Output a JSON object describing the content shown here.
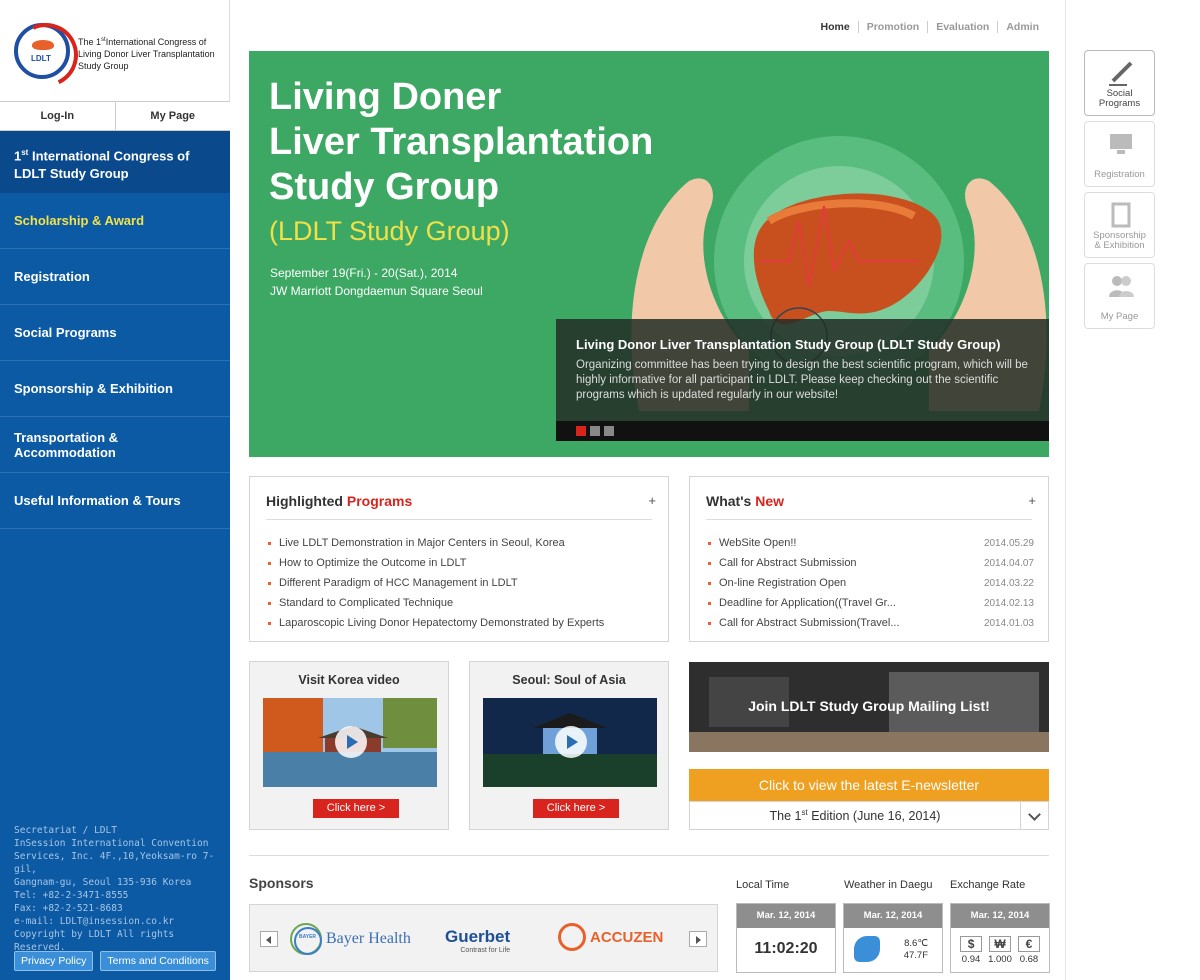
{
  "logo": {
    "badge": "LDLT",
    "title_prefix": "The 1",
    "title_sup": "st",
    "title_rest": "International Congress of Living Donor Liver Transplantation Study Group"
  },
  "account": {
    "login": "Log-In",
    "mypage": "My Page"
  },
  "nav": {
    "head_prefix": "1",
    "head_sup": "st",
    "head_rest": " International Congress of LDLT Study Group",
    "items": [
      {
        "label": "Scholarship & Award"
      },
      {
        "label": "Registration"
      },
      {
        "label": "Social Programs"
      },
      {
        "label": "Sponsorship & Exhibition"
      },
      {
        "label": "Transportation & Accommodation"
      },
      {
        "label": "Useful Information & Tours"
      }
    ]
  },
  "address": {
    "lines": [
      "Secretariat / LDLT",
      "InSession International Convention",
      "Services, Inc. 4F.,10,Yeoksam-ro 7-gil,",
      "Gangnam-gu, Seoul 135-936 Korea",
      "Tel: +82-2-3471-8555",
      "Fax: +82-2-521-8683",
      "e-mail: LDLT@insession.co.kr",
      "Copyright by LDLT All rights Reserved."
    ]
  },
  "footer": {
    "privacy": "Privacy Policy",
    "terms": "Terms and Conditions"
  },
  "topnav": {
    "home": "Home",
    "promotion": "Promotion",
    "evaluation": "Evaluation",
    "admin": "Admin"
  },
  "hero": {
    "title_line1": "Living Doner",
    "title_line2": "Liver Transplantation",
    "title_line3": "Study Group",
    "subtitle": "(LDLT Study Group)",
    "date": "September 19(Fri.) - 20(Sat.), 2014",
    "venue": "JW Marriott Dongdaemun Square Seoul",
    "caption_title": "Living Donor Liver Transplantation Study Group (LDLT  Study Group)",
    "caption_text": "Organizing committee has been trying to design the best scientific program, which will be highly informative for all participant in LDLT. Please keep checking out the scientific programs which is updated regularly in our website!"
  },
  "highlighted": {
    "title_a": "Highlighted ",
    "title_b": "Programs",
    "more": "+",
    "items": [
      "Live LDLT Demonstration in Major Centers in Seoul, Korea",
      "How to Optimize the Outcome in LDLT",
      "Different Paradigm of HCC Management in LDLT",
      "Standard to Complicated Technique",
      "Laparoscopic Living Donor Hepatectomy Demonstrated by Experts"
    ]
  },
  "whatsnew": {
    "title_a": "What's ",
    "title_b": "New",
    "more": "+",
    "items": [
      {
        "title": "WebSite Open!!",
        "date": "2014.05.29"
      },
      {
        "title": "Call for Abstract Submission",
        "date": "2014.04.07"
      },
      {
        "title": "On-line Registration Open",
        "date": "2014.03.22"
      },
      {
        "title": "Deadline for Application((Travel Gr...",
        "date": "2014.02.13"
      },
      {
        "title": "Call for Abstract Submission(Travel...",
        "date": "2014.01.03"
      }
    ]
  },
  "videos": [
    {
      "title": "Visit Korea video",
      "button": "Click here  >"
    },
    {
      "title": "Seoul: Soul of Asia",
      "button": "Click here  >"
    }
  ],
  "mailing": {
    "label": "Join LDLT Study Group Mailing List!"
  },
  "newsletter": {
    "banner": "Click to view the latest E-newsletter",
    "edition_prefix": "The 1",
    "edition_sup": "st",
    "edition_rest": " Edition (June 16, 2014)"
  },
  "sponsors": {
    "title": "Sponsors",
    "names": [
      "Bayer Health",
      "Guerbet",
      "Contrast for Life",
      "ACCUZEN"
    ],
    "bayer_mark": "BAYER"
  },
  "widgets": {
    "local_time": {
      "label": "Local Time",
      "date": "Mar. 12, 2014",
      "time": "11:02:20"
    },
    "weather": {
      "label": "Weather in Daegu",
      "date": "Mar. 12, 2014",
      "celsius": "8.6℃",
      "fahrenheit": "47.7F"
    },
    "exchange": {
      "label": "Exchange Rate",
      "date": "Mar. 12, 2014",
      "rates": [
        {
          "symbol": "$",
          "value": "0.94"
        },
        {
          "symbol": "₩",
          "value": "1.000"
        },
        {
          "symbol": "€",
          "value": "0.68"
        }
      ]
    }
  },
  "quick": [
    {
      "label_1": "Social",
      "label_2": "Programs"
    },
    {
      "label_1": "Registration",
      "label_2": ""
    },
    {
      "label_1": "Sponsorship",
      "label_2": "& Exhibition"
    },
    {
      "label_1": "My Page",
      "label_2": ""
    }
  ],
  "colors": {
    "brand_blue": "#0b5aa3",
    "accent_red": "#d9231d",
    "hero_green": "#3da863",
    "accent_orange": "#f0a020"
  }
}
